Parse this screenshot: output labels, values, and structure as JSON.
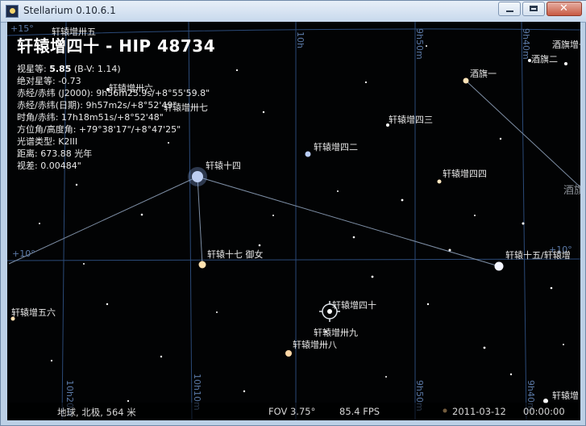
{
  "window": {
    "title": "Stellarium 0.10.6.1"
  },
  "object_info": {
    "name": "轩辕增四十 - HIP 48734",
    "magnitude_label": "视星等:",
    "magnitude_value": "5.85",
    "bv": "(B-V: 1.14)",
    "abs_magnitude": "绝对星等: -0.73",
    "radec_j2000": "赤经/赤纬 (J2000): 9h56m25.9s/+8°55'59.8\"",
    "radec_date": "赤经/赤纬(日期): 9h57m2s/+8°52'49\"",
    "hour_angle": "时角/赤纬: 17h18m51s/+8°52'48\"",
    "azimuth_alt": "方位角/高度角: +79°38'17\"/+8°47'25\"",
    "spectral_type": "光谱类型: K2III",
    "distance": "距离: 673.88 光年",
    "parallax": "视差: 0.00484\""
  },
  "star_labels": [
    "轩辕增卅五",
    "轩辕增卅六",
    "轩辕增卅七",
    "轩辕十四",
    "轩辕增四十",
    "轩辕增卅九",
    "轩辕增卅八",
    "轩辕十七 御女",
    "轩辕增四二",
    "轩辕增四三",
    "轩辕增四四",
    "轩辕十五/轩辕增",
    "酒旗一",
    "酒旗二",
    "酒旗增一",
    "酒旗",
    "轩辕增五六",
    "轩辕增"
  ],
  "grid_labels": {
    "dec_15": "+15°",
    "dec_10_left": "+10°",
    "dec_10_right": "+10°",
    "ra_10h": "10h",
    "ra_9h50m_top": "9h50m",
    "ra_9h40m_top": "9h40m",
    "ra_10h10m": "10h10m",
    "ra_10h20m": "10h20m",
    "ra_9h50m_bottom": "9h50m",
    "ra_9h40m_bottom": "9h40m"
  },
  "status": {
    "location": "地球, 北极, 564 米",
    "fov": "FOV 3.75°",
    "fps": "85.4 FPS",
    "date": "2011-03-12",
    "time": "00:00:00"
  },
  "colors": {
    "sky": "#020304",
    "grid": "#2b4a78",
    "constellation_line": "#7e8fa6",
    "label": "#e6e6e6"
  }
}
